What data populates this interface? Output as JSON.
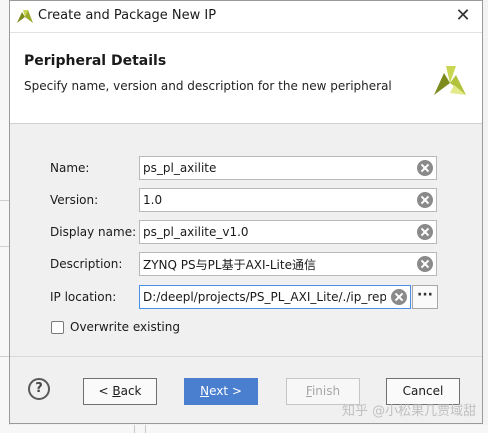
{
  "window": {
    "title": "Create and Package New IP",
    "close_glyph": "✕"
  },
  "header": {
    "title": "Peripheral Details",
    "subtitle": "Specify name, version and description for the new peripheral"
  },
  "form": {
    "name": {
      "label": "Name:",
      "value": "ps_pl_axilite"
    },
    "version": {
      "label": "Version:",
      "value": "1.0"
    },
    "display_name": {
      "label": "Display name:",
      "value": "ps_pl_axilite_v1.0"
    },
    "description": {
      "label": "Description:",
      "value": "ZYNQ PS与PL基于AXI-Lite通信"
    },
    "ip_location": {
      "label": "IP location:",
      "value": "D:/deepl/projects/PS_PL_AXI_Lite/./ip_repo"
    },
    "browse_label": "···",
    "overwrite": {
      "label": "Overwrite existing",
      "checked": false
    }
  },
  "footer": {
    "help_label": "?",
    "back": {
      "prefix": "< ",
      "mnemonic": "B",
      "rest": "ack"
    },
    "next": {
      "mnemonic": "N",
      "rest": "ext >"
    },
    "finish": {
      "mnemonic": "F",
      "rest": "inish"
    },
    "cancel_label": "Cancel"
  },
  "watermark": "知乎 @小松果几贾域甜",
  "icons": {
    "app": "vivado-logo-icon",
    "header_logo": "vivado-logo-icon",
    "clear": "clear-circle-icon",
    "help": "help-circle-icon"
  },
  "colors": {
    "accent": "#4a7fd0",
    "focus_border": "#4a90e2",
    "logo_dark": "#7d8b1c",
    "logo_light": "#c9d652"
  }
}
